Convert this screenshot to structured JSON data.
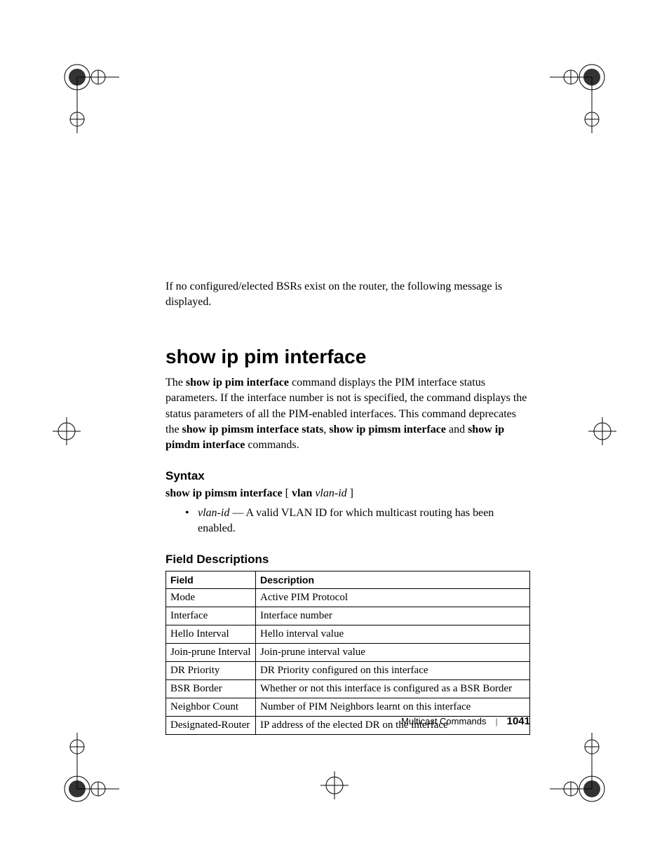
{
  "intro": "If no configured/elected BSRs exist on the router, the following message is displayed.",
  "heading": "show ip pim interface",
  "desc_parts": {
    "p1a": "The ",
    "p1b": "show ip pim interface",
    "p1c": " command displays the PIM interface status parameters. If the interface number is not is specified, the command displays the status parameters of all the PIM-enabled interfaces. This command deprecates the ",
    "p1d": "show ip pimsm interface stats",
    "p1e": ", ",
    "p1f": "show ip pimsm interface",
    "p1g": " and ",
    "p1h": "show ip pimdm interface",
    "p1i": " commands."
  },
  "syntax": {
    "heading": "Syntax",
    "line_parts": {
      "a": "show ip pimsm interface",
      "b": " [ ",
      "c": "vlan",
      "d": " ",
      "e": "vlan-id",
      "f": " ]"
    },
    "bullet": {
      "term": "vlan-id",
      "rest": " — A valid VLAN ID for which multicast routing has been enabled."
    }
  },
  "fields": {
    "heading": "Field Descriptions",
    "col1": "Field",
    "col2": "Description",
    "rows": [
      {
        "f": "Mode",
        "d": "Active PIM Protocol"
      },
      {
        "f": "Interface",
        "d": "Interface number"
      },
      {
        "f": "Hello Interval",
        "d": "Hello interval value"
      },
      {
        "f": "Join-prune Interval",
        "d": "Join-prune interval value"
      },
      {
        "f": "DR Priority",
        "d": "DR Priority configured on this interface"
      },
      {
        "f": "BSR Border",
        "d": "Whether or not this interface is configured as a BSR Border"
      },
      {
        "f": "Neighbor Count",
        "d": "Number of PIM Neighbors learnt on this interface"
      },
      {
        "f": "Designated-Router",
        "d": "IP address of the elected DR on the interface"
      }
    ]
  },
  "footer": {
    "section": "Multicast Commands",
    "page": "1041"
  }
}
